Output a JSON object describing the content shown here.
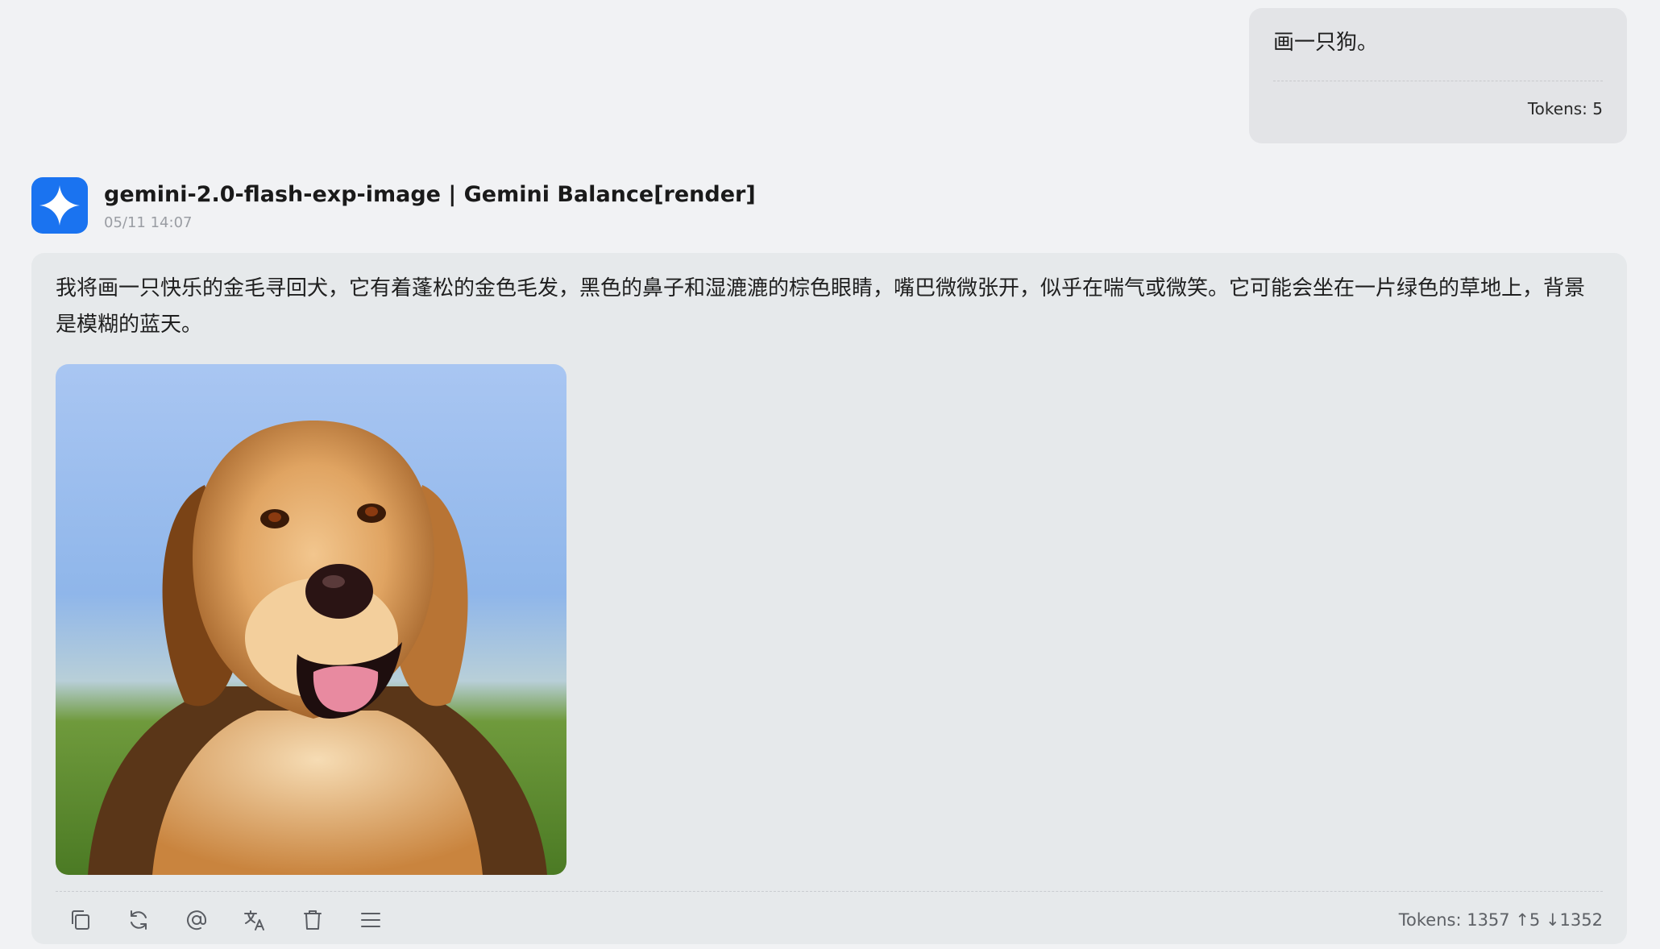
{
  "user_message": {
    "text": "画一只狗。",
    "tokens": "Tokens: 5"
  },
  "assistant": {
    "model": "gemini-2.0-flash-exp-image | Gemini Balance[render]",
    "timestamp": "05/11 14:07",
    "avatar_icon": "gemini-sparkle-icon",
    "text": "我将画一只快乐的金毛寻回犬，它有着蓬松的金色毛发，黑色的鼻子和湿漉漉的棕色眼睛，嘴巴微微张开，似乎在喘气或微笑。它可能会坐在一片绿色的草地上，背景是模糊的蓝天。",
    "tokens": "Tokens: 1357 ↑5 ↓1352",
    "actions": [
      "copy-icon",
      "refresh-icon",
      "at-icon",
      "translate-icon",
      "trash-icon",
      "menu-icon"
    ]
  },
  "colors": {
    "page_bg": "#f1f2f4",
    "user_bubble": "#e3e4e7",
    "assistant_card": "#e6e9eb",
    "accent_blue": "#1a73f0"
  }
}
